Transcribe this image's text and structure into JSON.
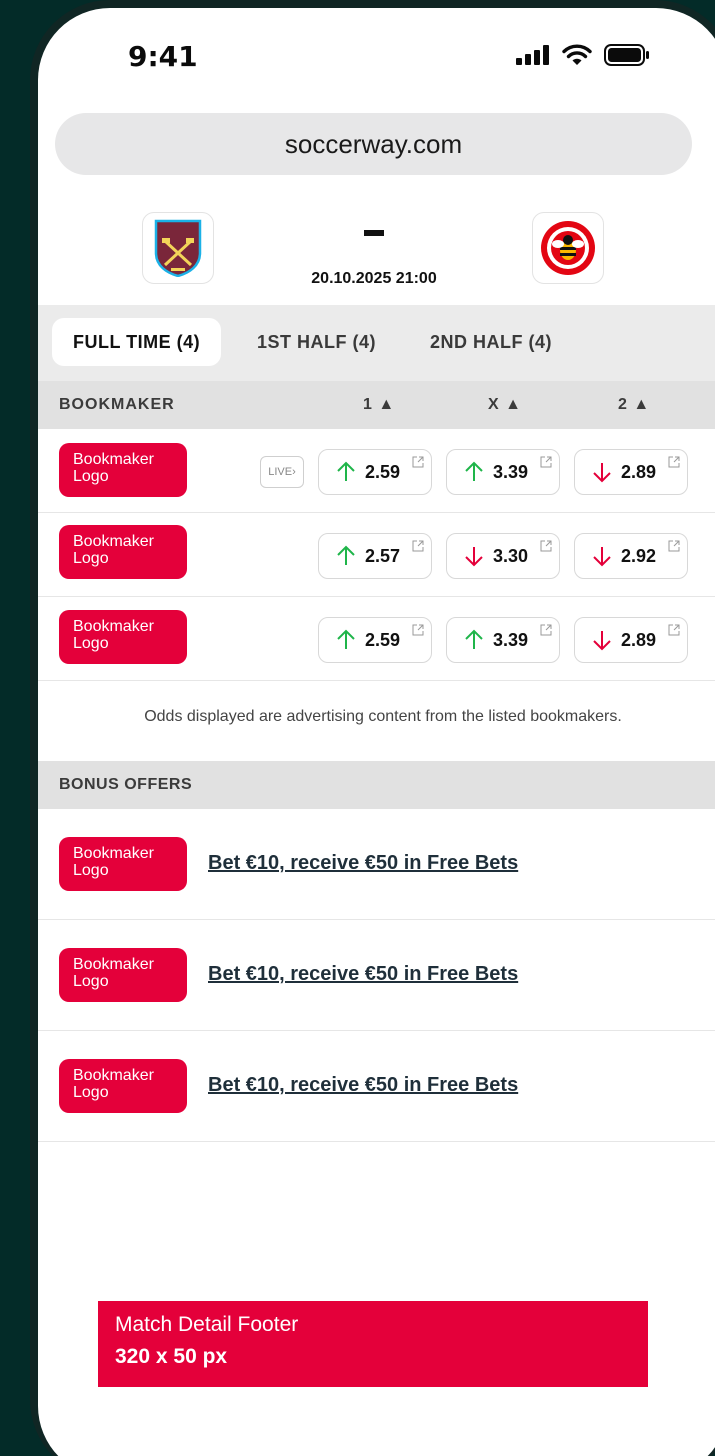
{
  "status_bar": {
    "time": "9:41"
  },
  "browser": {
    "url": "soccerway.com"
  },
  "match": {
    "home_crest_text": "WEST HAM UNITED",
    "away_crest_text": "BRENTFORD FOOTBALL CLUB",
    "score": "-",
    "datetime": "20.10.2025 21:00"
  },
  "tabs": [
    {
      "label": "FULL TIME (4)",
      "active": true
    },
    {
      "label": "1ST HALF (4)",
      "active": false
    },
    {
      "label": "2ND HALF (4)",
      "active": false
    }
  ],
  "odds_table": {
    "headers": {
      "bookmaker": "BOOKMAKER",
      "col1": "1 ▲",
      "colx": "X ▲",
      "col2": "2 ▲"
    },
    "rows": [
      {
        "logo": "Bookmaker Logo",
        "live": "LIVE›",
        "odds": [
          {
            "value": "2.59",
            "trend": "up"
          },
          {
            "value": "3.39",
            "trend": "up"
          },
          {
            "value": "2.89",
            "trend": "down"
          }
        ]
      },
      {
        "logo": "Bookmaker Logo",
        "live": "",
        "odds": [
          {
            "value": "2.57",
            "trend": "up"
          },
          {
            "value": "3.30",
            "trend": "down"
          },
          {
            "value": "2.92",
            "trend": "down"
          }
        ]
      },
      {
        "logo": "Bookmaker Logo",
        "live": "",
        "odds": [
          {
            "value": "2.59",
            "trend": "up"
          },
          {
            "value": "3.39",
            "trend": "up"
          },
          {
            "value": "2.89",
            "trend": "down"
          }
        ]
      }
    ],
    "disclaimer": "Odds displayed are advertising content from the listed bookmakers."
  },
  "bonus": {
    "header": "BONUS OFFERS",
    "offers": [
      {
        "logo": "Bookmaker Logo",
        "text": "Bet €10, receive €50 in Free Bets"
      },
      {
        "logo": "Bookmaker Logo",
        "text": "Bet €10, receive €50 in Free Bets"
      },
      {
        "logo": "Bookmaker Logo",
        "text": "Bet €10, receive €50 in Free Bets"
      }
    ]
  },
  "footer_ad": {
    "line1": "Match Detail Footer",
    "line2": "320 x 50 px"
  },
  "colors": {
    "accent": "#e4003a",
    "up": "#1fb54a",
    "down": "#e4003a",
    "background": "#032b28"
  }
}
